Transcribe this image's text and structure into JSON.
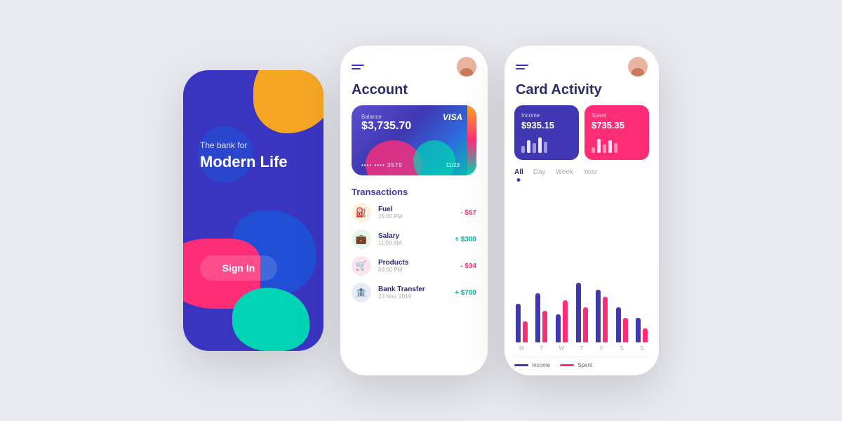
{
  "phone1": {
    "tagline": "The bank for",
    "title": "Modern Life",
    "signin": "Sign In"
  },
  "phone2": {
    "page_title": "Account",
    "card": {
      "balance_label": "Balance",
      "balance_amount": "$3,735.70",
      "card_number": "•••• •••• 3579",
      "expiry": "11/23",
      "network": "VISA"
    },
    "transactions_title": "Transactions",
    "transactions": [
      {
        "name": "Fuel",
        "time": "15:00 PM",
        "amount": "- $57",
        "type": "negative",
        "icon": "⛽"
      },
      {
        "name": "Salary",
        "time": "11:00 AM",
        "amount": "+ $300",
        "type": "positive",
        "icon": "💼"
      },
      {
        "name": "Products",
        "time": "09:00 PM",
        "amount": "- $34",
        "type": "negative",
        "icon": "🛒"
      },
      {
        "name": "Bank Transfer",
        "time": "23 Nov, 2019",
        "amount": "+ $700",
        "type": "positive",
        "icon": "🏦"
      }
    ]
  },
  "phone3": {
    "page_title": "Card Activity",
    "income": {
      "label": "Income",
      "amount": "$935.15"
    },
    "spent": {
      "label": "Spent",
      "amount": "$735.35"
    },
    "periods": [
      "All",
      "Day",
      "Week",
      "Year"
    ],
    "active_period": "All",
    "chart_days": [
      "M",
      "T",
      "W",
      "T",
      "F",
      "S",
      "S"
    ],
    "chart_data": [
      {
        "income": 55,
        "spent": 30
      },
      {
        "income": 70,
        "spent": 45
      },
      {
        "income": 40,
        "spent": 60
      },
      {
        "income": 85,
        "spent": 50
      },
      {
        "income": 75,
        "spent": 65
      },
      {
        "income": 50,
        "spent": 35
      },
      {
        "income": 35,
        "spent": 20
      }
    ],
    "legend": {
      "income": "Income",
      "spent": "Spent"
    }
  }
}
